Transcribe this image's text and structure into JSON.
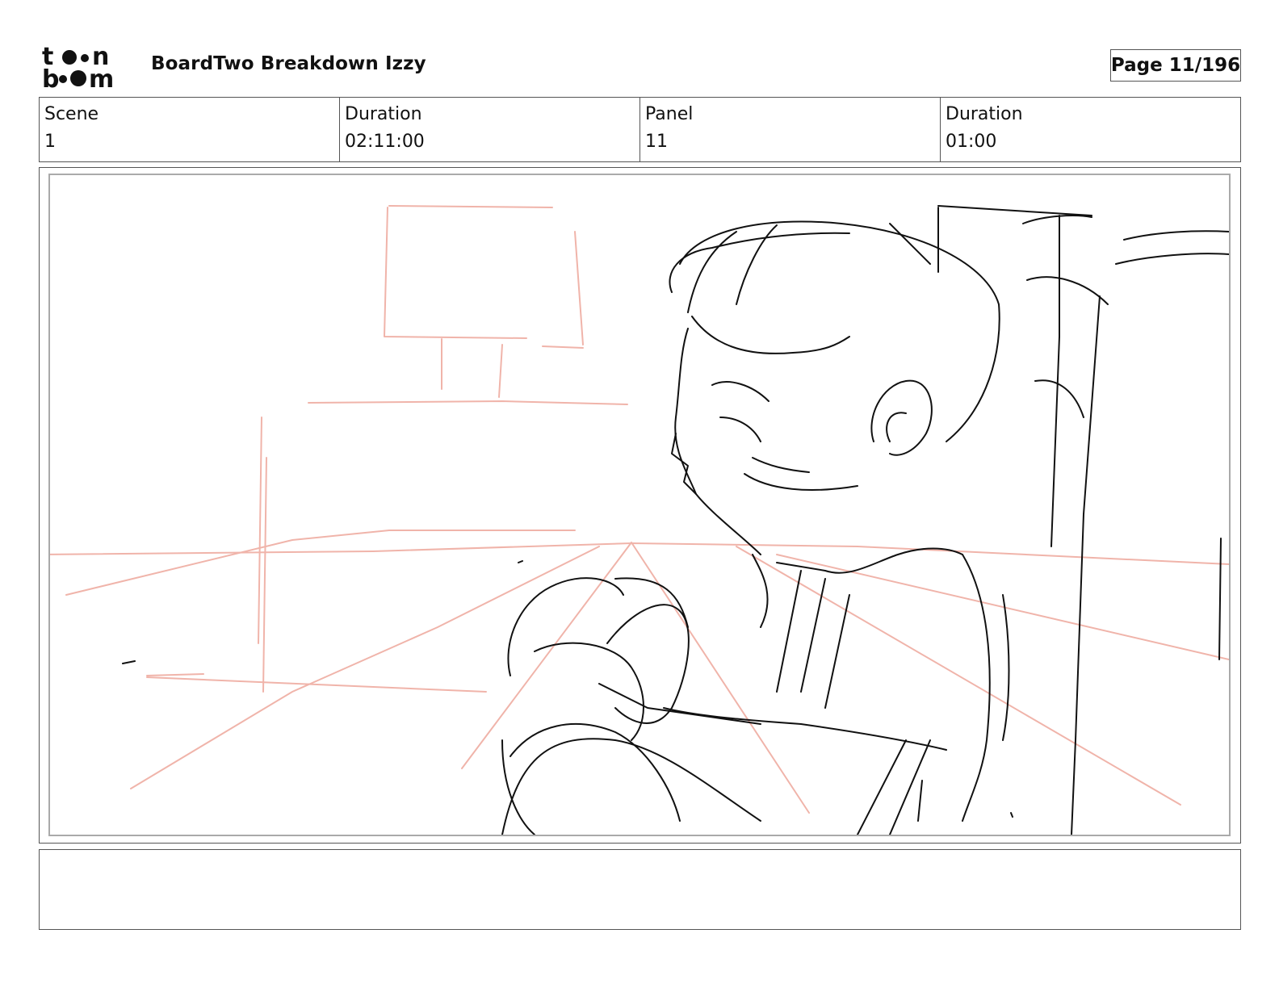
{
  "header": {
    "logo_text": "toonboom",
    "project_title": "BoardTwo Breakdown Izzy",
    "page_label": "Page",
    "page_value": "11/196"
  },
  "info": {
    "scene_label": "Scene",
    "scene_value": "1",
    "scene_duration_label": "Duration",
    "scene_duration_value": "02:11:00",
    "panel_label": "Panel",
    "panel_value": "11",
    "panel_duration_label": "Duration",
    "panel_duration_value": "01:00"
  },
  "panel": {
    "image": "rough-sketch-boy-seated",
    "colors": {
      "sketch_line": "#111111",
      "guide_line": "#f0b4aa"
    }
  },
  "notes": {
    "text": ""
  }
}
